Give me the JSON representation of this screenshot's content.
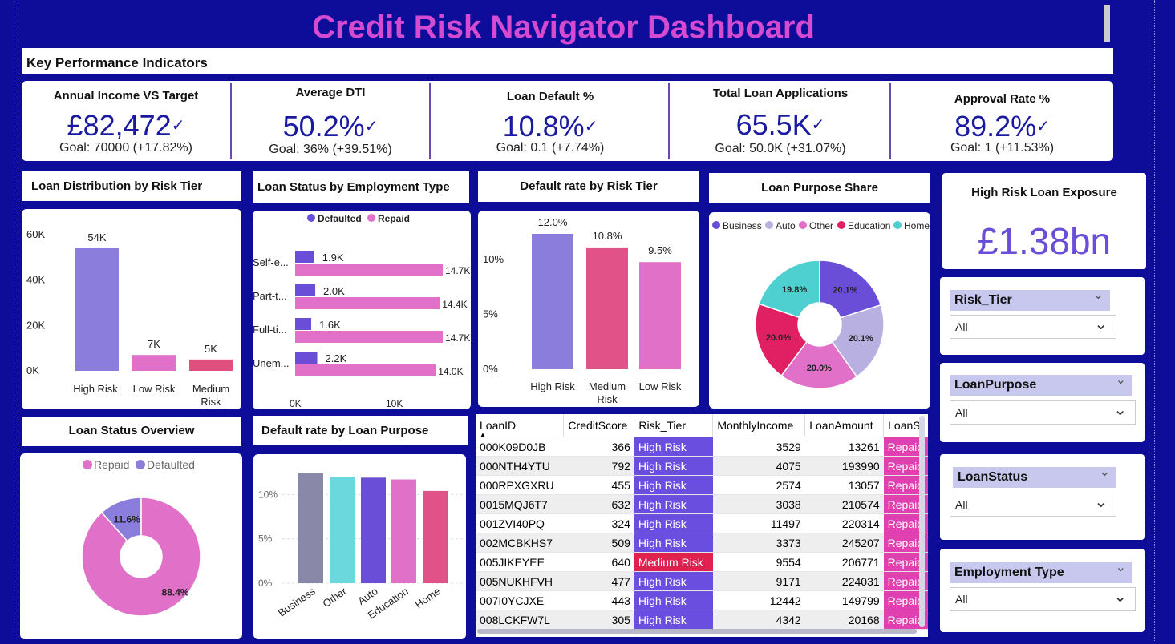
{
  "title": "Credit Risk Navigator Dashboard",
  "kpi_header": "Key Performance Indicators",
  "kpis": [
    {
      "title": "Annual Income VS Target",
      "value": "£82,472",
      "goal": "Goal: 70000 (+17.82%)"
    },
    {
      "title": "Average DTI",
      "value": "50.2%",
      "goal": "Goal: 36% (+39.51%)"
    },
    {
      "title": "Loan Default %",
      "value": "10.8%",
      "goal": "Goal: 0.1 (+7.74%)"
    },
    {
      "title": "Total  Loan Applications",
      "value": "65.5K",
      "goal": "Goal: 50.0K (+31.07%)"
    },
    {
      "title": "Approval Rate %",
      "value": "89.2%",
      "goal": "Goal: 1 (+11.53%)"
    }
  ],
  "check_glyph": "✓",
  "exposure": {
    "title": "High Risk Loan Exposure",
    "value": "£1.38bn"
  },
  "slicers": [
    {
      "label": "Risk_Tier",
      "value": "All"
    },
    {
      "label": "LoanPurpose",
      "value": "All"
    },
    {
      "label": "LoanStatus",
      "value": "All"
    },
    {
      "label": "Employment Type",
      "value": "All"
    }
  ],
  "chevron_glyph": "⌄",
  "chart_titles": {
    "risk_tier": "Loan Distribution by Risk Tier",
    "employment": "Loan Status by Employment Type",
    "default_tier": "Default rate by Risk Tier",
    "purpose_share": "Loan Purpose Share",
    "status_overview": "Loan Status Overview",
    "default_purpose": "Default rate by Loan Purpose"
  },
  "colors": {
    "purple": "#8a7ddc",
    "pink": "#e070c8",
    "red": "#e0507e",
    "navy": "#0d0d9a",
    "title": "#d44ad0"
  },
  "chart_data": [
    {
      "id": "risk_tier",
      "type": "bar",
      "categories": [
        "High Risk",
        "Low Risk",
        "Medium Risk"
      ],
      "values": [
        54000,
        7000,
        5000
      ],
      "labels": [
        "54K",
        "7K",
        "5K"
      ],
      "yticks": [
        "0K",
        "20K",
        "40K",
        "60K"
      ],
      "ylim": [
        0,
        60000
      ]
    },
    {
      "id": "employment",
      "type": "bar",
      "orientation": "horizontal",
      "categories": [
        "Self-e...",
        "Part-t...",
        "Full-ti...",
        "Unem..."
      ],
      "series": [
        {
          "name": "Defaulted",
          "values": [
            1900,
            2000,
            1600,
            2200
          ],
          "labels": [
            "1.9K",
            "2.0K",
            "1.6K",
            "2.2K"
          ]
        },
        {
          "name": "Repaid",
          "values": [
            14700,
            14400,
            14700,
            14000
          ],
          "labels": [
            "14.7K",
            "14.4K",
            "14.7K",
            "14.0K"
          ]
        }
      ],
      "xticks": [
        "0K",
        "10K"
      ],
      "xlim": [
        0,
        14700
      ]
    },
    {
      "id": "default_tier",
      "type": "bar",
      "categories": [
        "High Risk",
        "Medium Risk",
        "Low Risk"
      ],
      "values": [
        12.0,
        10.8,
        9.5
      ],
      "labels": [
        "12.0%",
        "10.8%",
        "9.5%"
      ],
      "yticks": [
        "0%",
        "5%",
        "10%"
      ],
      "ylim": [
        0,
        14
      ]
    },
    {
      "id": "purpose_share",
      "type": "pie",
      "categories": [
        "Business",
        "Auto",
        "Other",
        "Education",
        "Home"
      ],
      "values": [
        20.1,
        20.1,
        20.0,
        20.0,
        19.8
      ],
      "labels": [
        "20.1%",
        "20.1%",
        "20.0%",
        "20.0%",
        "19.8%"
      ]
    },
    {
      "id": "status_overview",
      "type": "pie",
      "categories": [
        "Repaid",
        "Defaulted"
      ],
      "values": [
        88.4,
        11.6
      ],
      "labels": [
        "88.4%",
        "11.6%"
      ]
    },
    {
      "id": "default_purpose",
      "type": "bar",
      "categories": [
        "Business",
        "Other",
        "Auto",
        "Education",
        "Home"
      ],
      "values": [
        12.4,
        12.0,
        11.9,
        11.7,
        10.4
      ],
      "yticks": [
        "0%",
        "5%",
        "10%",
        "15%"
      ],
      "ylim": [
        0,
        15
      ]
    }
  ],
  "table": {
    "columns": [
      "LoanID",
      "CreditScore",
      "Risk_Tier",
      "MonthlyIncome",
      "LoanAmount",
      "LoanS"
    ],
    "rows": [
      [
        "000K09D0JB",
        "366",
        "High Risk",
        "3529",
        "13261",
        "Repaid"
      ],
      [
        "000NTH4YTU",
        "792",
        "High Risk",
        "4075",
        "193990",
        "Repaid"
      ],
      [
        "000RPXGXRU",
        "455",
        "High Risk",
        "2574",
        "13057",
        "Repaid"
      ],
      [
        "0015MQJ6T7",
        "632",
        "High Risk",
        "3038",
        "210574",
        "Repaid"
      ],
      [
        "001ZVI40PQ",
        "324",
        "High Risk",
        "11497",
        "220314",
        "Repaid"
      ],
      [
        "002MCBKHS7",
        "509",
        "High Risk",
        "3373",
        "245207",
        "Repaid"
      ],
      [
        "005JIKEYEE",
        "640",
        "Medium Risk",
        "9554",
        "206771",
        "Repaid"
      ],
      [
        "005NUKHFVH",
        "477",
        "High Risk",
        "9171",
        "224031",
        "Repaid"
      ],
      [
        "007I0YCJXE",
        "443",
        "High Risk",
        "12442",
        "149799",
        "Repaid"
      ],
      [
        "008LCKFW7L",
        "305",
        "High Risk",
        "4342",
        "20168",
        "Repaid"
      ]
    ]
  }
}
